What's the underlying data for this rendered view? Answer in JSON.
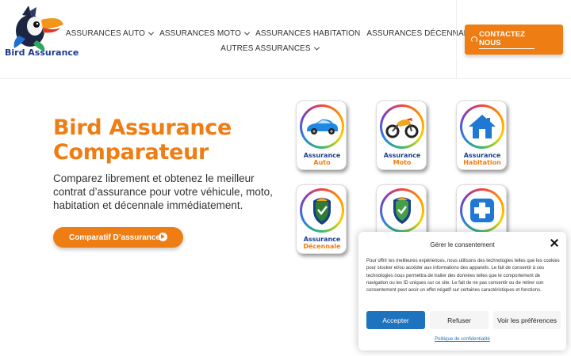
{
  "header": {
    "logo_text": "Bird Assurance",
    "nav_row1": [
      "ASSURANCES AUTO",
      "ASSURANCES MOTO",
      "ASSURANCES HABITATION",
      "ASSURANCES DÉCENNALE"
    ],
    "nav_row2": [
      "AUTRES ASSURANCES"
    ],
    "contact_label": "CONTACTEZ NOUS"
  },
  "hero": {
    "title_line1": "Bird Assurance",
    "title_line2": "Comparateur",
    "description": "Comparez librement et obtenez le meilleur contrat d’assurance pour votre véhicule, moto, habitation et décennale immédiatement.",
    "cta_label": "Comparatif D’assurance"
  },
  "cards": [
    {
      "line1": "Assurance",
      "line2": "Auto",
      "icon": "car-icon"
    },
    {
      "line1": "Assurance",
      "line2": "Moto",
      "icon": "motorcycle-icon"
    },
    {
      "line1": "Assurance",
      "line2": "Habitation",
      "icon": "house-icon"
    },
    {
      "line1": "Assurance",
      "line2": "Décennale",
      "icon": "shield-worker-icon"
    },
    {
      "line1": "",
      "line2": "",
      "icon": "shield-check-icon"
    },
    {
      "line1": "",
      "line2": "",
      "icon": "medical-cross-icon"
    }
  ],
  "consent": {
    "title": "Gérer le consentement",
    "text": "Pour offrir les meilleures expériences, nous utilisons des technologies telles que les cookies pour stocker et/ou accéder aux informations des appareils. Le fait de consentir à ces technologies nous permettra de traiter des données telles que le comportement de navigation ou les ID uniques sur ce site. Le fait de ne pas consentir ou de retirer son consentement peut avoir un effet négatif sur certaines caractéristiques et fonctions.",
    "accept_label": "Accepter",
    "refuse_label": "Refuser",
    "prefs_label": "Voir les préférences",
    "policy_link": "Politique de confidentialité"
  },
  "colors": {
    "accent": "#ee7d14",
    "brand_blue": "#1a3e8c",
    "accept_blue": "#1e73be"
  }
}
